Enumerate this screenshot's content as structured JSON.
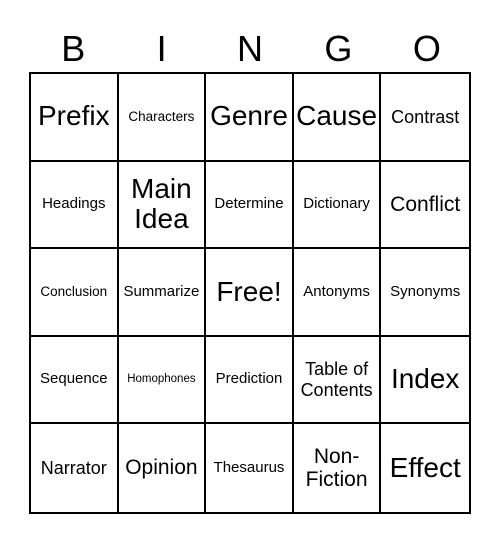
{
  "header": [
    "B",
    "I",
    "N",
    "G",
    "O"
  ],
  "cells": [
    [
      "Prefix",
      "Characters",
      "Genre",
      "Cause",
      "Contrast"
    ],
    [
      "Headings",
      "Main Idea",
      "Determine",
      "Dictionary",
      "Conflict"
    ],
    [
      "Conclusion",
      "Summarize",
      "Free!",
      "Antonyms",
      "Synonyms"
    ],
    [
      "Sequence",
      "Homophones",
      "Prediction",
      "Table of Contents",
      "Index"
    ],
    [
      "Narrator",
      "Opinion",
      "Thesaurus",
      "Non-Fiction",
      "Effect"
    ]
  ]
}
